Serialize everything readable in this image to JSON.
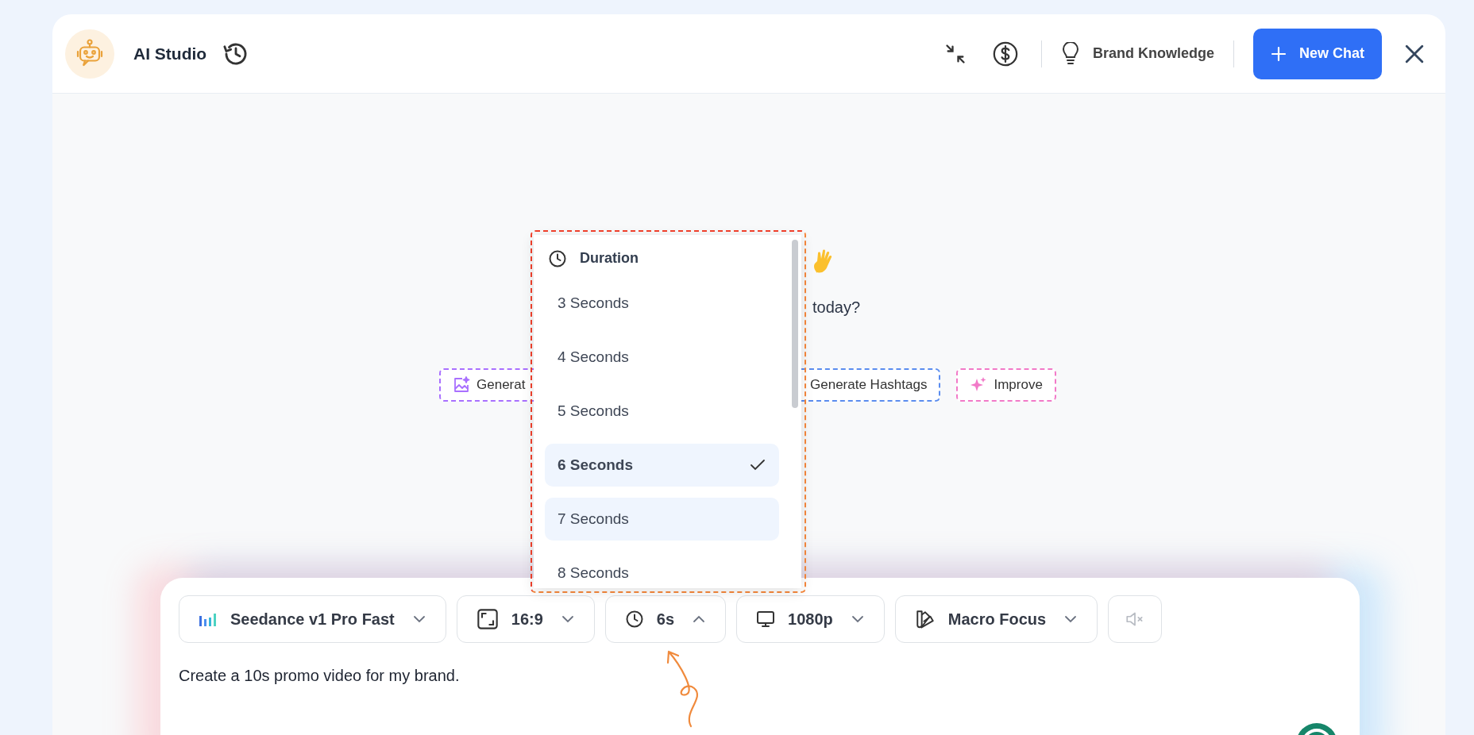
{
  "header": {
    "title": "AI Studio",
    "brand_knowledge": "Brand Knowledge",
    "new_chat": "New Chat"
  },
  "welcome": {
    "text": "today?"
  },
  "suggestions": [
    {
      "kind": "image",
      "label": "Generat",
      "color": "#a970ff"
    },
    {
      "kind": "none",
      "label": "Generate Hashtags",
      "color": "#5b8def"
    },
    {
      "kind": "sparkle",
      "label": "Improve",
      "color": "#f27ac8"
    }
  ],
  "toolbar": [
    {
      "kind": "model",
      "label": "Seedance v1 Pro Fast",
      "expanded": false
    },
    {
      "kind": "ratio",
      "label": "16:9",
      "expanded": false
    },
    {
      "kind": "duration",
      "label": "6s",
      "expanded": true
    },
    {
      "kind": "resolution",
      "label": "1080p",
      "expanded": false
    },
    {
      "kind": "style",
      "label": "Macro Focus",
      "expanded": false
    },
    {
      "kind": "mute"
    }
  ],
  "duration_menu": {
    "title": "Duration",
    "options": [
      {
        "label": "3 Seconds",
        "selected": false,
        "highlighted": false
      },
      {
        "label": "4 Seconds",
        "selected": false,
        "highlighted": false
      },
      {
        "label": "5 Seconds",
        "selected": false,
        "highlighted": false
      },
      {
        "label": "6 Seconds",
        "selected": true,
        "highlighted": false
      },
      {
        "label": "7 Seconds",
        "selected": false,
        "highlighted": true
      },
      {
        "label": "8 Seconds",
        "selected": false,
        "highlighted": false
      }
    ]
  },
  "prompt": {
    "value": "Create a 10s promo video for my brand."
  }
}
